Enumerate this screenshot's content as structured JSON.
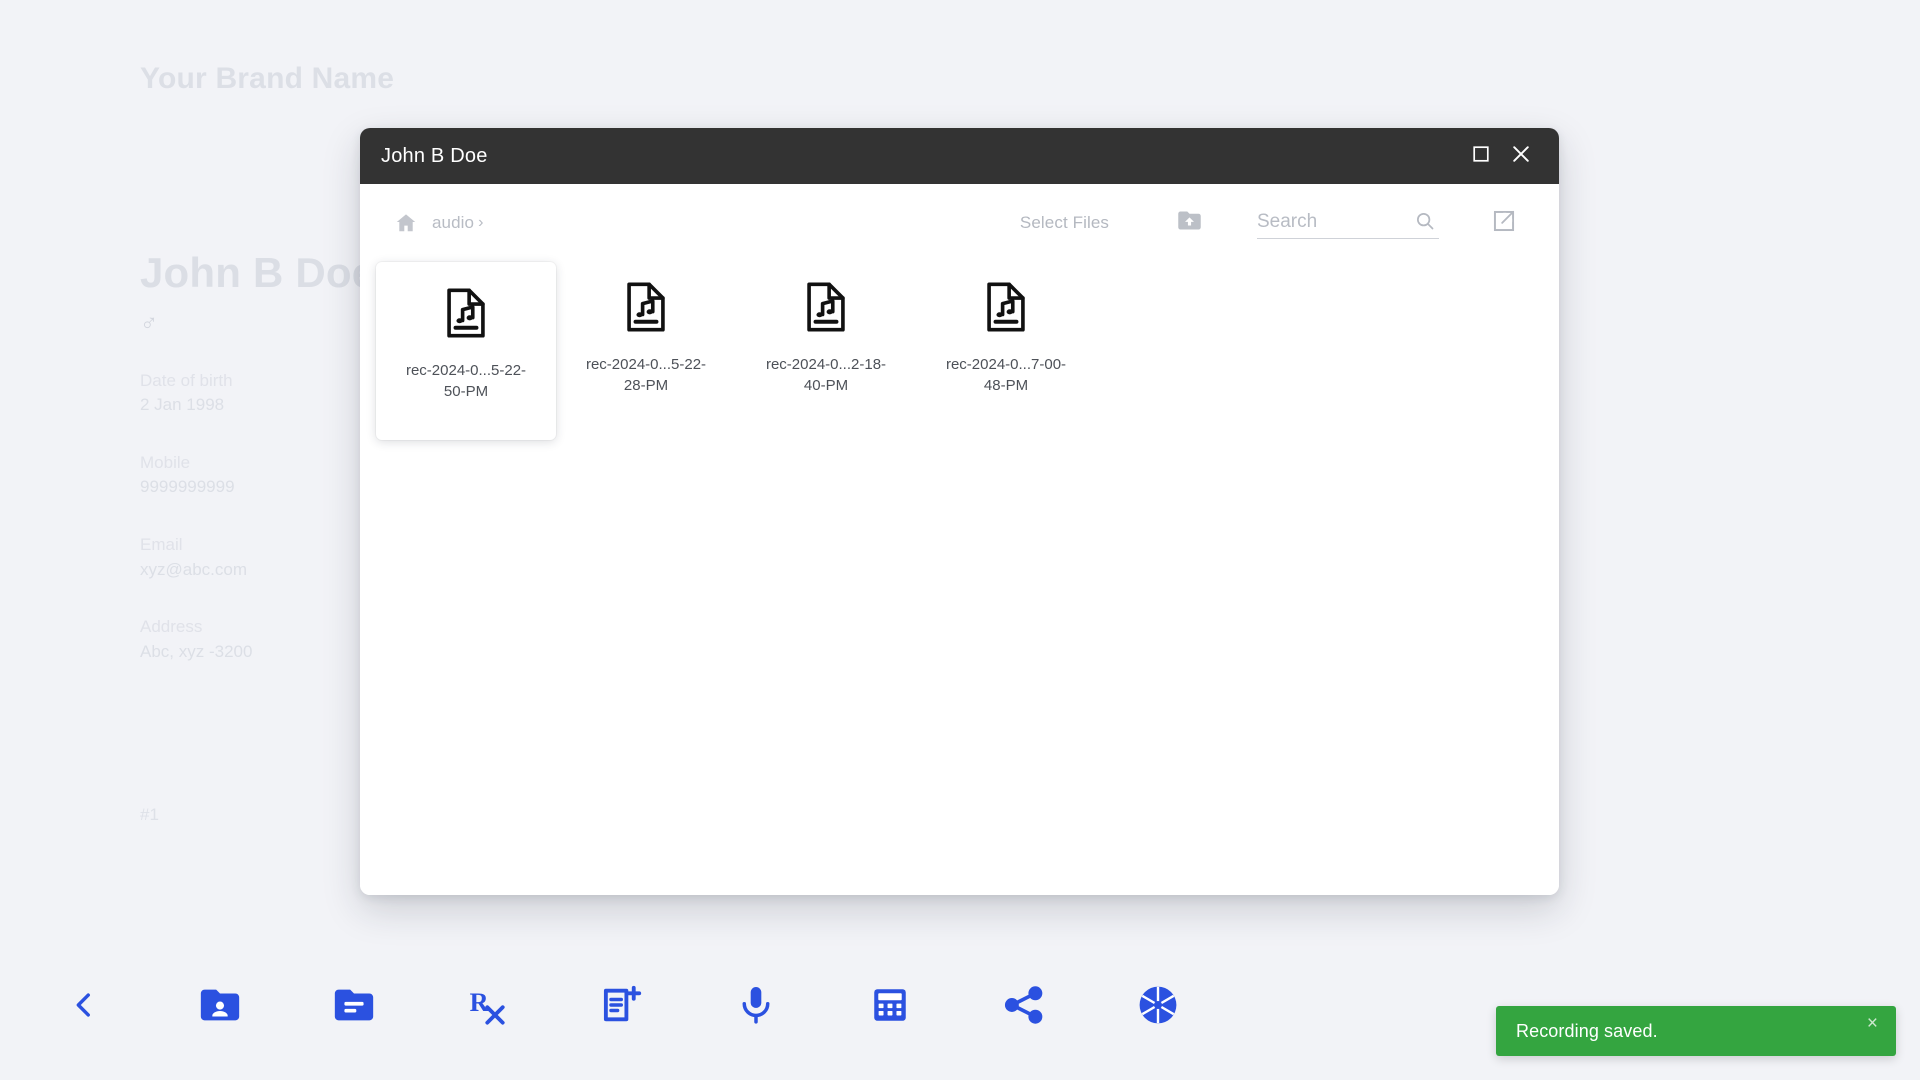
{
  "background": {
    "brand_name": "Your Brand Name",
    "patient": {
      "name": "John B Doe",
      "gender_symbol": "♂",
      "details": [
        {
          "label": "Date of birth",
          "value": "2 Jan 1998"
        },
        {
          "label": "Mobile",
          "value": "9999999999"
        },
        {
          "label": "Email",
          "value": "xyz@abc.com"
        },
        {
          "label": "Address",
          "value": "Abc, xyz -3200"
        }
      ],
      "record_id": "#1"
    }
  },
  "bottom_toolbar": {
    "items": [
      {
        "name": "back-button",
        "icon": "chevron-left-icon"
      },
      {
        "name": "patient-folder-button",
        "icon": "folder-shared-icon"
      },
      {
        "name": "records-folder-button",
        "icon": "folder-notes-icon"
      },
      {
        "name": "prescription-button",
        "icon": "rx-icon"
      },
      {
        "name": "add-note-button",
        "icon": "note-add-icon"
      },
      {
        "name": "record-audio-button",
        "icon": "microphone-icon"
      },
      {
        "name": "calculator-button",
        "icon": "calculator-icon"
      },
      {
        "name": "share-button",
        "icon": "share-icon"
      },
      {
        "name": "camera-button",
        "icon": "camera-aperture-icon"
      }
    ],
    "accent_color": "#2b51e0"
  },
  "dialog": {
    "title": "John B Doe",
    "titlebar_color": "#333333",
    "window_controls": [
      {
        "name": "maximize-button",
        "icon": "maximize-icon"
      },
      {
        "name": "close-button",
        "icon": "close-icon"
      }
    ],
    "toolbar": {
      "breadcrumb": {
        "home_icon": "home-icon",
        "crumb": "audio",
        "separator": "›"
      },
      "select_files_label": "Select Files",
      "upload_icon": "drive-folder-upload-icon",
      "search": {
        "placeholder": "Search",
        "value": "",
        "icon": "search-icon"
      },
      "open_external_icon": "open-in-new-icon"
    },
    "files": [
      {
        "name": "rec-2024-0...5-22-50-PM",
        "icon": "audio-file-icon",
        "selected": true
      },
      {
        "name": "rec-2024-0...5-22-28-PM",
        "icon": "audio-file-icon",
        "selected": false
      },
      {
        "name": "rec-2024-0...2-18-40-PM",
        "icon": "audio-file-icon",
        "selected": false
      },
      {
        "name": "rec-2024-0...7-00-48-PM",
        "icon": "audio-file-icon",
        "selected": false
      }
    ]
  },
  "toast": {
    "message": "Recording saved.",
    "close_label": "×",
    "background_color": "#34a540"
  }
}
